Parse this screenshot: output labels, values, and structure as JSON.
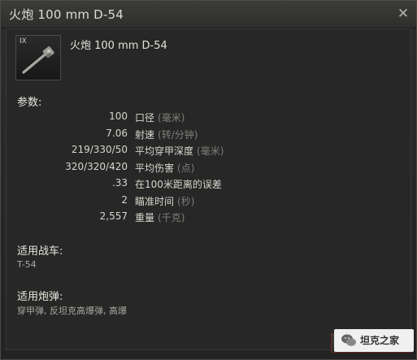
{
  "window": {
    "title": "火炮 100 mm D-54"
  },
  "module": {
    "tier": "IX",
    "name": "火炮 100 mm D-54"
  },
  "params": {
    "title": "参数:",
    "rows": [
      {
        "value": "100",
        "label": "口径",
        "unit": "(毫米)"
      },
      {
        "value": "7.06",
        "label": "射速",
        "unit": "(转/分钟)"
      },
      {
        "value": "219/330/50",
        "label": "平均穿甲深度",
        "unit": "(毫米)"
      },
      {
        "value": "320/320/420",
        "label": "平均伤害",
        "unit": "(点)"
      },
      {
        "value": ".33",
        "label": "在100米距离的误差",
        "unit": ""
      },
      {
        "value": "2",
        "label": "瞄准时间",
        "unit": "(秒)"
      },
      {
        "value": "2,557",
        "label": "重量",
        "unit": "(千克)"
      }
    ]
  },
  "vehicles": {
    "title": "适用战车:",
    "list": "T-54"
  },
  "ammo": {
    "title": "适用炮弹:",
    "list": "穿甲弹, 反坦克高爆弹, 高爆"
  },
  "button": {
    "label": ""
  },
  "watermark": {
    "text": "坦克之家"
  },
  "colors": {
    "accent_border": "#6b2820",
    "text": "#d8d6ce",
    "unit": "#7f7e78"
  }
}
